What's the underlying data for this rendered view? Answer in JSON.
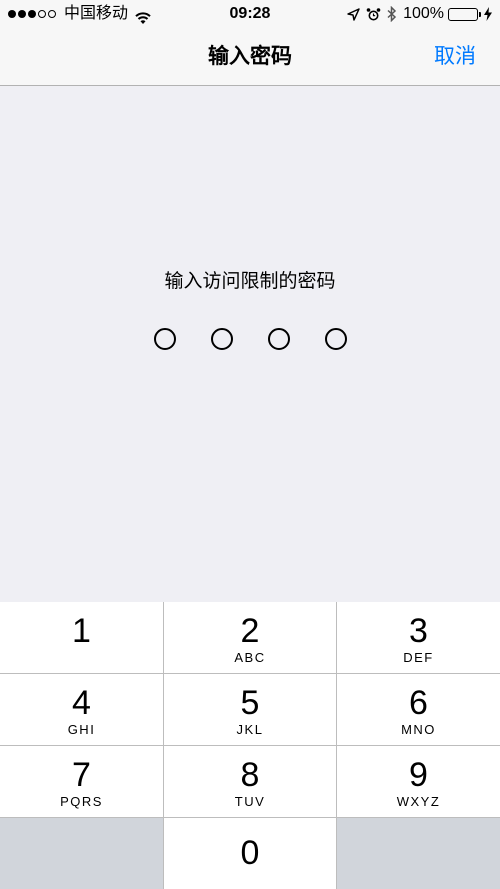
{
  "status_bar": {
    "carrier": "中国移动",
    "time": "09:28",
    "battery_percent": "100%",
    "battery_level": 1.0,
    "icons": [
      "signal-dots-icon",
      "wifi-icon",
      "location-arrow-icon",
      "alarm-icon",
      "bluetooth-icon",
      "battery-icon",
      "charging-icon"
    ]
  },
  "nav": {
    "title": "输入密码",
    "cancel_label": "取消"
  },
  "prompt": "输入访问限制的密码",
  "passcode_length": 4,
  "keypad": {
    "k1": {
      "num": "1",
      "letters": ""
    },
    "k2": {
      "num": "2",
      "letters": "ABC"
    },
    "k3": {
      "num": "3",
      "letters": "DEF"
    },
    "k4": {
      "num": "4",
      "letters": "GHI"
    },
    "k5": {
      "num": "5",
      "letters": "JKL"
    },
    "k6": {
      "num": "6",
      "letters": "MNO"
    },
    "k7": {
      "num": "7",
      "letters": "PQRS"
    },
    "k8": {
      "num": "8",
      "letters": "TUV"
    },
    "k9": {
      "num": "9",
      "letters": "WXYZ"
    },
    "k0": {
      "num": "0",
      "letters": ""
    }
  },
  "colors": {
    "accent": "#007aff",
    "background": "#efeff4",
    "battery": "#4cd964"
  }
}
